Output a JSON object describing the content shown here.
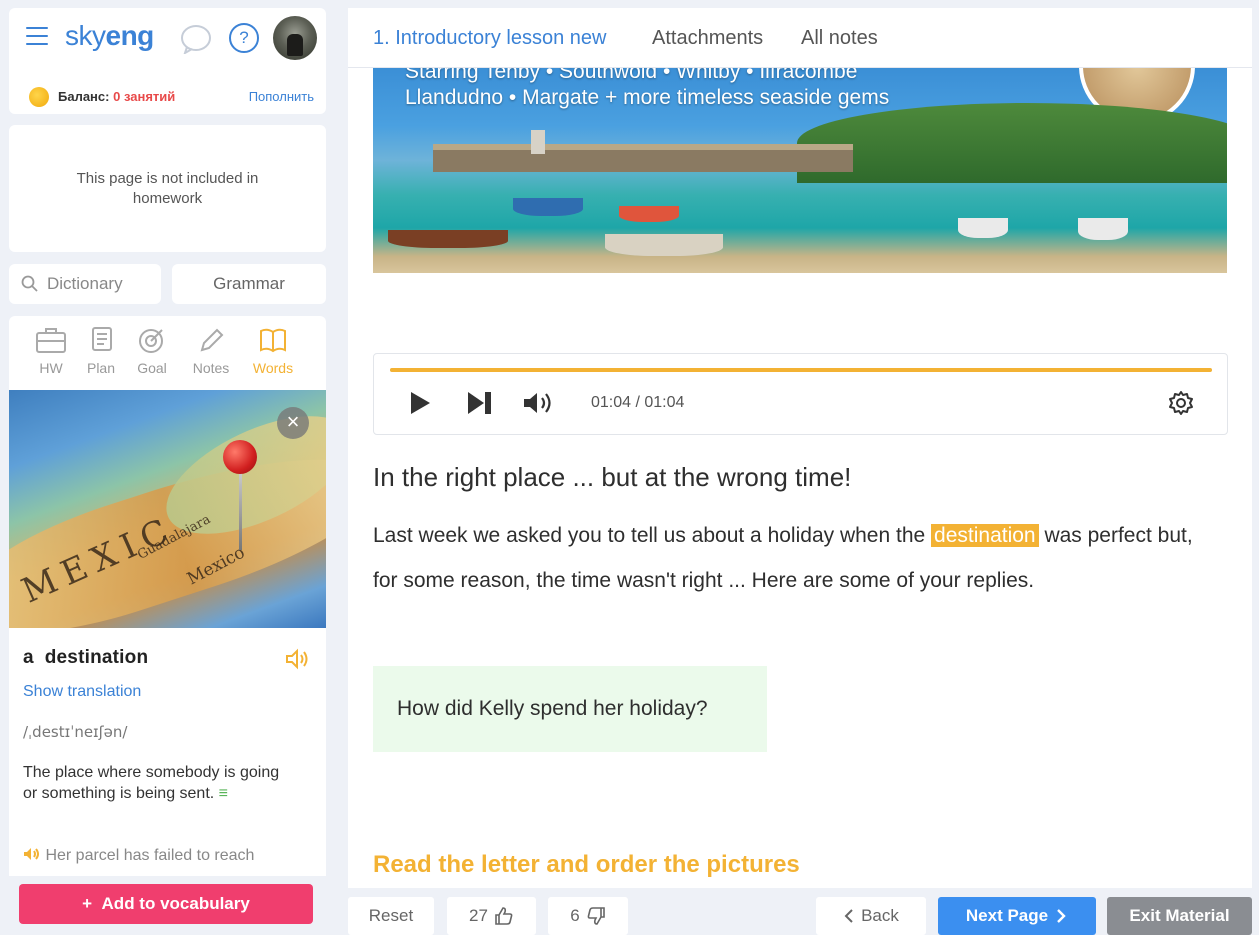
{
  "sidebar": {
    "logo": {
      "prefix": "sky",
      "suffix": "eng"
    },
    "balance": {
      "label": "Баланс:",
      "value": "0 занятий",
      "topup": "Пополнить"
    },
    "homework_note": "This page is not included in homework",
    "dictionary_label": "Dictionary",
    "grammar_label": "Grammar",
    "tools": [
      {
        "label": "HW",
        "icon": "briefcase-icon"
      },
      {
        "label": "Plan",
        "icon": "plan-icon"
      },
      {
        "label": "Goal",
        "icon": "target-icon"
      },
      {
        "label": "Notes",
        "icon": "pencil-icon"
      },
      {
        "label": "Words",
        "icon": "book-icon",
        "active": true
      }
    ],
    "word_image_text": {
      "map_word": "MEXIC",
      "city": "Guadalajara",
      "country": "Mexico"
    },
    "word": {
      "title": "a  destination",
      "show_translation": "Show translation",
      "transcription": "/ˌdestɪˈneɪʃən/",
      "definition": "The place where somebody is going or something is being sent.",
      "definition_icon": "≡",
      "example": "Her parcel has failed to reach"
    },
    "add_vocab": "Add to vocabulary",
    "add_vocab_plus": "+"
  },
  "main": {
    "tabs": [
      {
        "label": "1. Introductory lesson new",
        "active": true
      },
      {
        "label": "Attachments"
      },
      {
        "label": "All notes"
      }
    ],
    "photo_caption_top": "Starring Tenby • Southwold • Whitby • Ilfracombe",
    "photo_caption": "Llandudno • Margate + more timeless seaside gems",
    "player": {
      "time": "01:04 / 01:04",
      "progress": 1.0
    },
    "heading": "In the right place ... but at the wrong time!",
    "body_before": "Last week we asked you to tell us about a holiday when the ",
    "body_highlight": "destination",
    "body_after": " was perfect but, for some reason, the time wasn't right ... Here are some of your replies.",
    "question": "How did Kelly spend her holiday?",
    "task_title": "Read the letter and order the pictures"
  },
  "bottom_bar": {
    "reset": "Reset",
    "likes": "27",
    "dislikes": "6",
    "back": "Back",
    "next": "Next Page",
    "exit": "Exit Material"
  },
  "colors": {
    "accent_blue": "#3b82d6",
    "accent_yellow": "#f3b234",
    "add_button": "#f03e6e",
    "balance_red": "#e84a4a"
  }
}
